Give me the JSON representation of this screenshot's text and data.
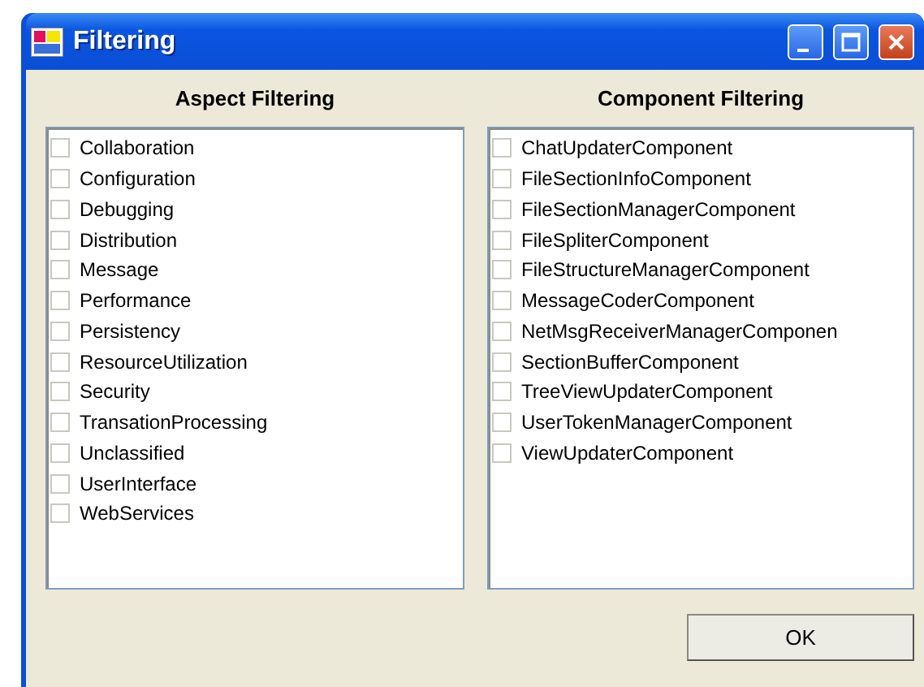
{
  "window": {
    "title": "Filtering"
  },
  "aspect_filtering": {
    "heading": "Aspect Filtering",
    "items": [
      {
        "label": "Collaboration",
        "checked": false
      },
      {
        "label": "Configuration",
        "checked": false
      },
      {
        "label": "Debugging",
        "checked": false
      },
      {
        "label": "Distribution",
        "checked": false
      },
      {
        "label": "Message",
        "checked": false
      },
      {
        "label": "Performance",
        "checked": false
      },
      {
        "label": "Persistency",
        "checked": false
      },
      {
        "label": "ResourceUtilization",
        "checked": false
      },
      {
        "label": "Security",
        "checked": false
      },
      {
        "label": "TransationProcessing",
        "checked": false
      },
      {
        "label": "Unclassified",
        "checked": false
      },
      {
        "label": "UserInterface",
        "checked": false
      },
      {
        "label": "WebServices",
        "checked": false
      }
    ]
  },
  "component_filtering": {
    "heading": "Component Filtering",
    "items": [
      {
        "label": "ChatUpdaterComponent",
        "checked": false
      },
      {
        "label": "FileSectionInfoComponent",
        "checked": false
      },
      {
        "label": "FileSectionManagerComponent",
        "checked": false
      },
      {
        "label": "FileSpliterComponent",
        "checked": false
      },
      {
        "label": "FileStructureManagerComponent",
        "checked": false
      },
      {
        "label": "MessageCoderComponent",
        "checked": false
      },
      {
        "label": "NetMsgReceiverManagerComponen",
        "checked": false
      },
      {
        "label": "SectionBufferComponent",
        "checked": false
      },
      {
        "label": "TreeViewUpdaterComponent",
        "checked": false
      },
      {
        "label": "UserTokenManagerComponent",
        "checked": false
      },
      {
        "label": "ViewUpdaterComponent",
        "checked": false
      }
    ]
  },
  "buttons": [
    "OK"
  ]
}
